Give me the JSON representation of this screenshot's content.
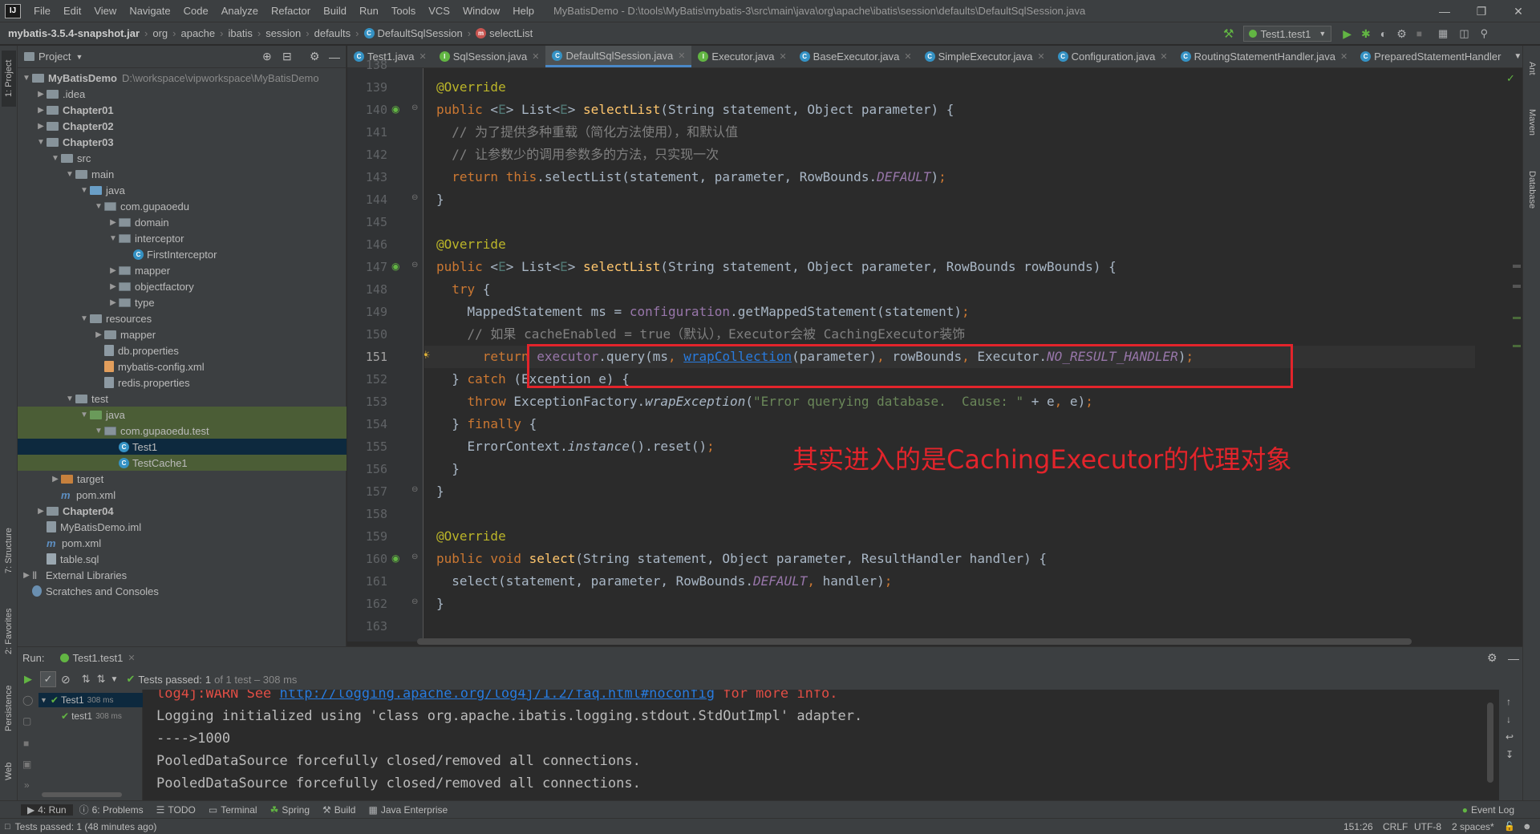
{
  "menubar": {
    "logo": "IJ",
    "items": [
      "File",
      "Edit",
      "View",
      "Navigate",
      "Code",
      "Analyze",
      "Refactor",
      "Build",
      "Run",
      "Tools",
      "VCS",
      "Window",
      "Help"
    ],
    "title": "MyBatisDemo - D:\\tools\\MyBatis\\mybatis-3\\src\\main\\java\\org\\apache\\ibatis\\session\\defaults\\DefaultSqlSession.java"
  },
  "navbar": {
    "crumbs": [
      "mybatis-3.5.4-snapshot.jar",
      "org",
      "apache",
      "ibatis",
      "session",
      "defaults",
      "DefaultSqlSession",
      "selectList"
    ],
    "run_config": "Test1.test1"
  },
  "project": {
    "header": "Project",
    "tree": [
      {
        "label": "MyBatisDemo",
        "hint": "D:\\workspace\\vipworkspace\\MyBatisDemo",
        "indent": 0,
        "arrow": "v",
        "icon": "folder",
        "bold": true
      },
      {
        "label": ".idea",
        "indent": 1,
        "arrow": ">",
        "icon": "folder"
      },
      {
        "label": "Chapter01",
        "indent": 1,
        "arrow": ">",
        "icon": "folder",
        "bold": true
      },
      {
        "label": "Chapter02",
        "indent": 1,
        "arrow": ">",
        "icon": "folder",
        "bold": true
      },
      {
        "label": "Chapter03",
        "indent": 1,
        "arrow": "v",
        "icon": "folder",
        "bold": true
      },
      {
        "label": "src",
        "indent": 2,
        "arrow": "v",
        "icon": "folder"
      },
      {
        "label": "main",
        "indent": 3,
        "arrow": "v",
        "icon": "folder"
      },
      {
        "label": "java",
        "indent": 4,
        "arrow": "v",
        "icon": "folder-blue"
      },
      {
        "label": "com.gupaoedu",
        "indent": 5,
        "arrow": "v",
        "icon": "pkg"
      },
      {
        "label": "domain",
        "indent": 6,
        "arrow": ">",
        "icon": "pkg"
      },
      {
        "label": "interceptor",
        "indent": 6,
        "arrow": "v",
        "icon": "pkg"
      },
      {
        "label": "FirstInterceptor",
        "indent": 7,
        "arrow": "",
        "icon": "class"
      },
      {
        "label": "mapper",
        "indent": 6,
        "arrow": ">",
        "icon": "pkg"
      },
      {
        "label": "objectfactory",
        "indent": 6,
        "arrow": ">",
        "icon": "pkg"
      },
      {
        "label": "type",
        "indent": 6,
        "arrow": ">",
        "icon": "pkg"
      },
      {
        "label": "resources",
        "indent": 4,
        "arrow": "v",
        "icon": "folder"
      },
      {
        "label": "mapper",
        "indent": 5,
        "arrow": ">",
        "icon": "folder"
      },
      {
        "label": "db.properties",
        "indent": 5,
        "arrow": "",
        "icon": "props"
      },
      {
        "label": "mybatis-config.xml",
        "indent": 5,
        "arrow": "",
        "icon": "xml"
      },
      {
        "label": "redis.properties",
        "indent": 5,
        "arrow": "",
        "icon": "props"
      },
      {
        "label": "test",
        "indent": 3,
        "arrow": "v",
        "icon": "folder"
      },
      {
        "label": "java",
        "indent": 4,
        "arrow": "v",
        "icon": "folder-green"
      },
      {
        "label": "com.gupaoedu.test",
        "indent": 5,
        "arrow": "v",
        "icon": "pkg"
      },
      {
        "label": "Test1",
        "indent": 6,
        "arrow": "",
        "icon": "class",
        "state": "sel"
      },
      {
        "label": "TestCache1",
        "indent": 6,
        "arrow": "",
        "icon": "class"
      },
      {
        "label": "target",
        "indent": 2,
        "arrow": ">",
        "icon": "folder-orange"
      },
      {
        "label": "pom.xml",
        "indent": 2,
        "arrow": "",
        "icon": "m"
      },
      {
        "label": "Chapter04",
        "indent": 1,
        "arrow": ">",
        "icon": "folder",
        "bold": true
      },
      {
        "label": "MyBatisDemo.iml",
        "indent": 1,
        "arrow": "",
        "icon": "props"
      },
      {
        "label": "pom.xml",
        "indent": 1,
        "arrow": "",
        "icon": "m"
      },
      {
        "label": "table.sql",
        "indent": 1,
        "arrow": "",
        "icon": "sql"
      },
      {
        "label": "External Libraries",
        "indent": 0,
        "arrow": ">",
        "icon": "lib"
      },
      {
        "label": "Scratches and Consoles",
        "indent": 0,
        "arrow": "",
        "icon": "scratch"
      }
    ]
  },
  "side_tabs": {
    "left": [
      "1: Project",
      "7: Structure",
      "2: Favorites",
      "Persistence",
      "Web"
    ],
    "right": [
      "Ant",
      "Maven",
      "Database"
    ]
  },
  "tabs": [
    {
      "label": "Test1.java",
      "icon": "C"
    },
    {
      "label": "SqlSession.java",
      "icon": "I"
    },
    {
      "label": "DefaultSqlSession.java",
      "icon": "C",
      "active": true
    },
    {
      "label": "Executor.java",
      "icon": "I"
    },
    {
      "label": "BaseExecutor.java",
      "icon": "C"
    },
    {
      "label": "SimpleExecutor.java",
      "icon": "C"
    },
    {
      "label": "Configuration.java",
      "icon": "C"
    },
    {
      "label": "RoutingStatementHandler.java",
      "icon": "C"
    },
    {
      "label": "PreparedStatementHandler",
      "icon": "C"
    }
  ],
  "editor": {
    "line_numbers": [
      "138",
      "139",
      "140",
      "141",
      "142",
      "143",
      "144",
      "145",
      "146",
      "147",
      "148",
      "149",
      "150",
      "151",
      "152",
      "153",
      "154",
      "155",
      "156",
      "157",
      "158",
      "159",
      "160",
      "161",
      "162",
      "163"
    ],
    "current_line": "151",
    "annotation": "其实进入的是CachingExecutor的代理对象"
  },
  "run": {
    "label": "Run:",
    "config_tab": "Test1.test1",
    "tests_passed": "Tests passed:",
    "tests_count": "1",
    "tests_detail": "of 1 test – 308 ms",
    "tree": [
      {
        "label": "Test1",
        "time": "308 ms"
      },
      {
        "label": "test1",
        "time": "308 ms"
      }
    ],
    "console": [
      "log4j:WARN See http://logging.apache.org/log4j/1.2/faq.html#noconfig for more info.",
      "Logging initialized using 'class org.apache.ibatis.logging.stdout.StdOutImpl' adapter.",
      "---->1000",
      "PooledDataSource forcefully closed/removed all connections.",
      "PooledDataSource forcefully closed/removed all connections."
    ],
    "warn_prefix": "log4j:WARN See ",
    "warn_link": "http://logging.apache.org/log4j/1.2/faq.html#noconfig",
    "warn_suffix": " for more info."
  },
  "bottom_tabs": [
    "4: Run",
    "6: Problems",
    "TODO",
    "Terminal",
    "Spring",
    "Build",
    "Java Enterprise"
  ],
  "event_log": "Event Log",
  "status": {
    "message": "Tests passed: 1 (48 minutes ago)",
    "position": "151:26",
    "line_sep": "CRLF",
    "encoding": "UTF-8",
    "indent": "2 spaces*"
  },
  "colors": {
    "highlight_box": "#e3242b",
    "keyword": "#cc7832",
    "annotation": "#bbb529",
    "method": "#ffc66d"
  }
}
